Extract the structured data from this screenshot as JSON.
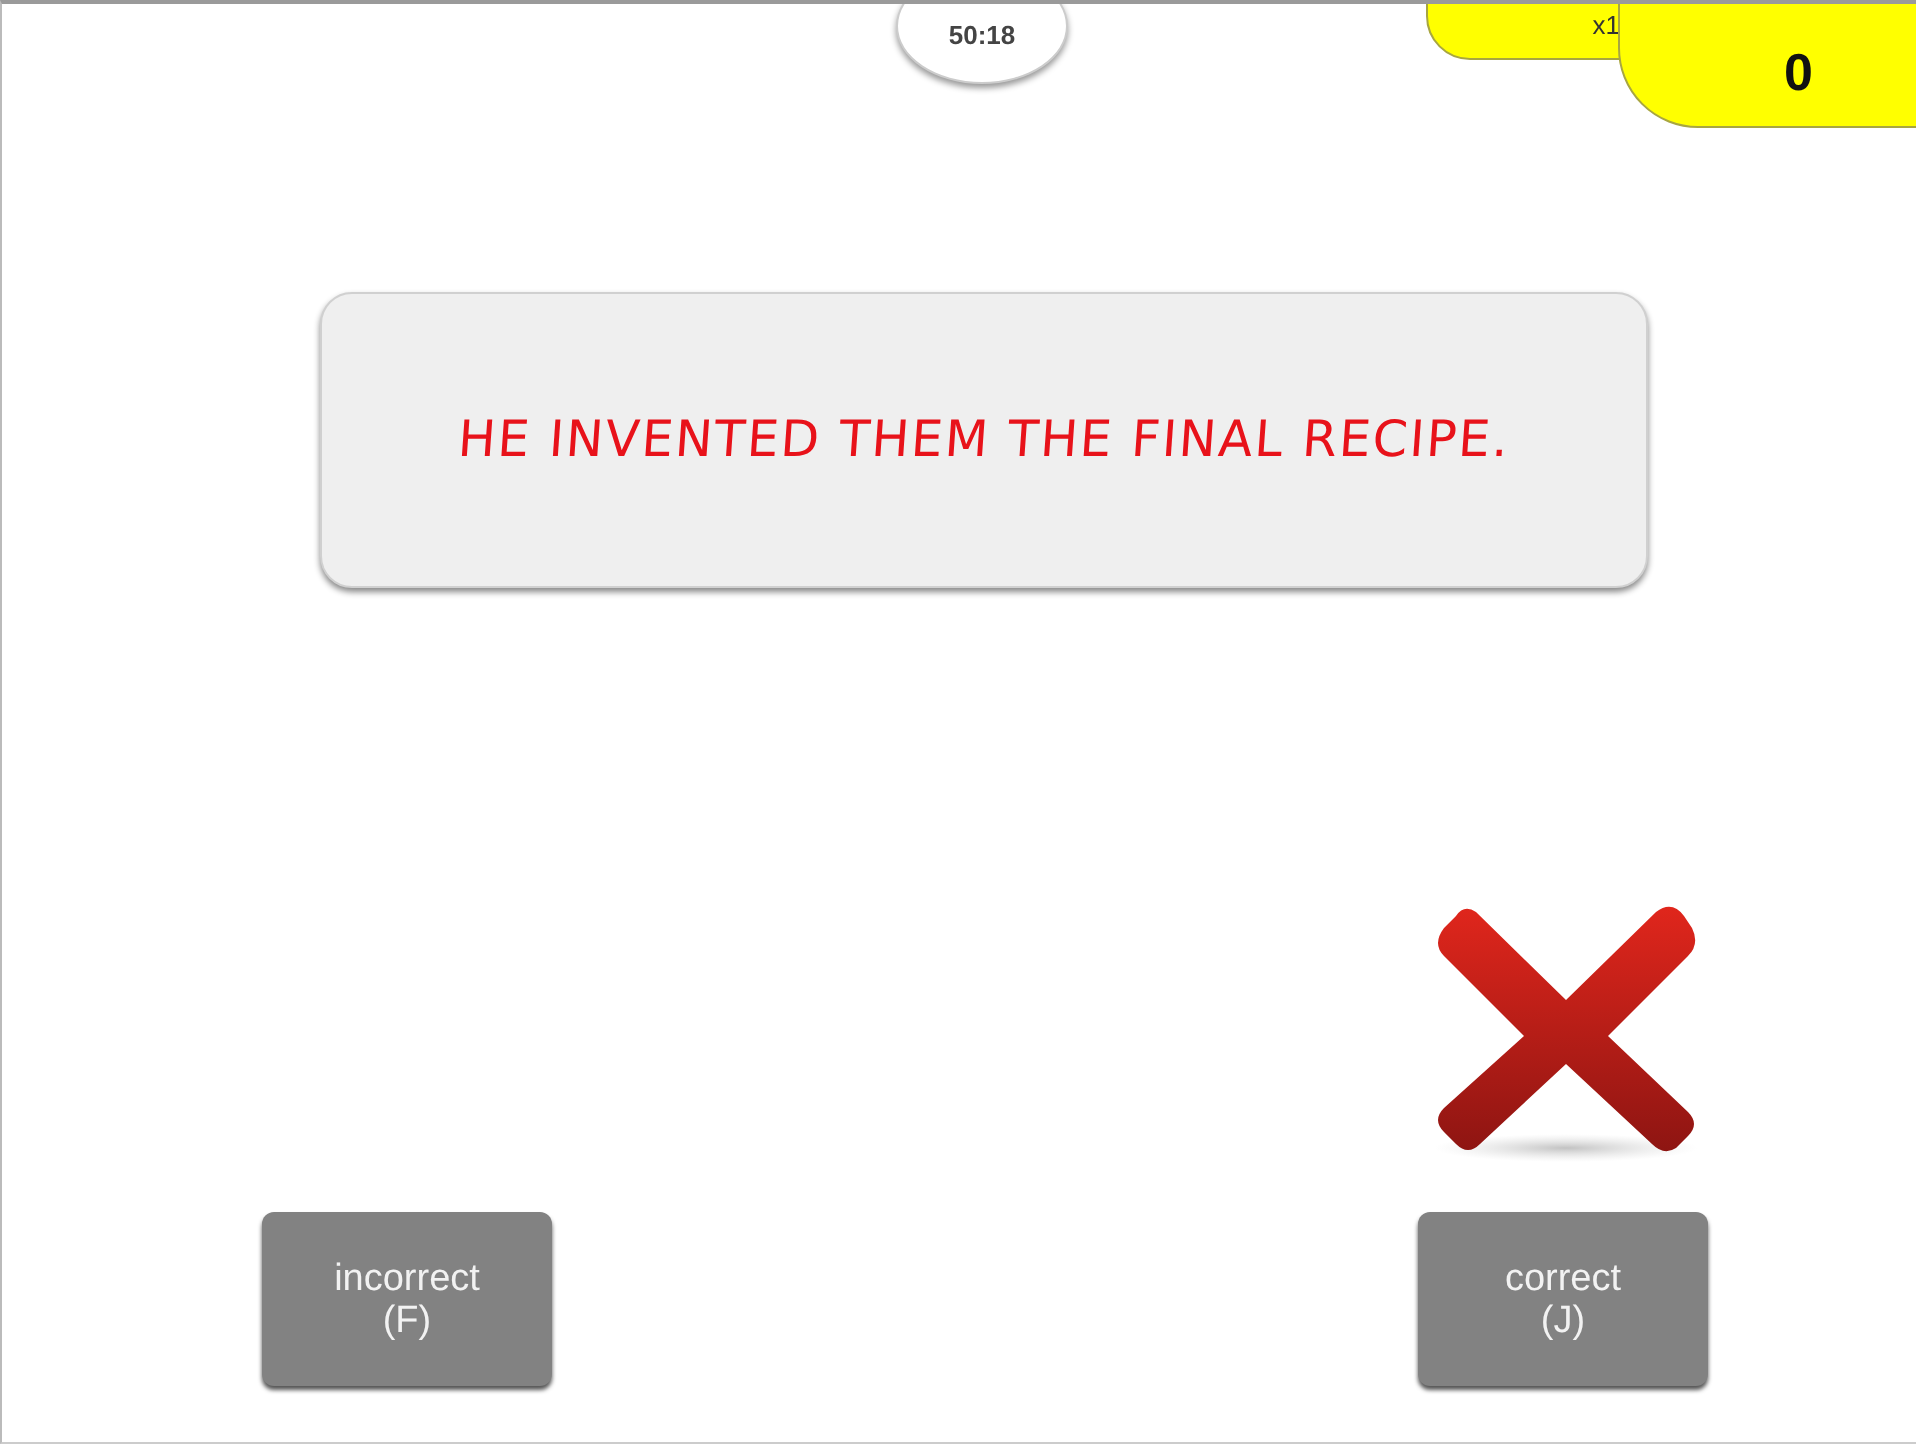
{
  "timer": "50:18",
  "multiplier": "x1",
  "score": "0",
  "sentence": "HE INVENTED THEM THE FINAL RECIPE.",
  "feedback": {
    "kind": "wrong"
  },
  "buttons": [
    {
      "label": "incorrect",
      "key": "(F)"
    },
    {
      "label": "correct",
      "key": "(J)"
    }
  ]
}
